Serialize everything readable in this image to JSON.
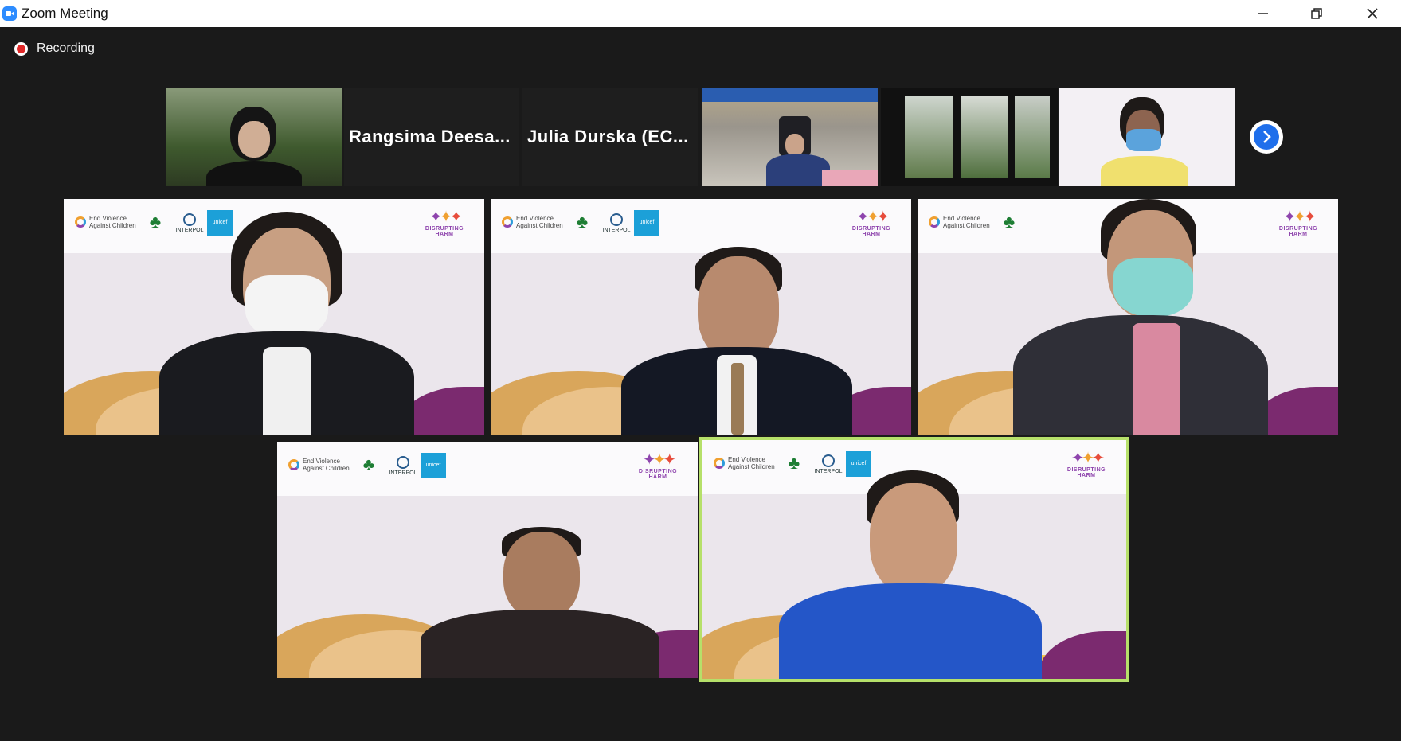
{
  "window": {
    "title": "Zoom Meeting",
    "minimize": "minimize",
    "restore": "restore",
    "close": "close"
  },
  "recording": {
    "label": "Recording"
  },
  "strip": {
    "names": [
      "Rangsima  Deesa...",
      "Julia  Durska  (EC..."
    ],
    "next_icon": "chevron-right-icon"
  },
  "gallery": {
    "banner": {
      "evac_line1": "End Violence",
      "evac_line2": "Against Children",
      "interpol": "INTERPOL",
      "unicef": "unicef",
      "dh": "DISRUPTING HARM"
    }
  },
  "colors": {
    "active_speaker": "#b6e06a",
    "background": "#1a1a1a",
    "next_button": "#1f6feb"
  }
}
